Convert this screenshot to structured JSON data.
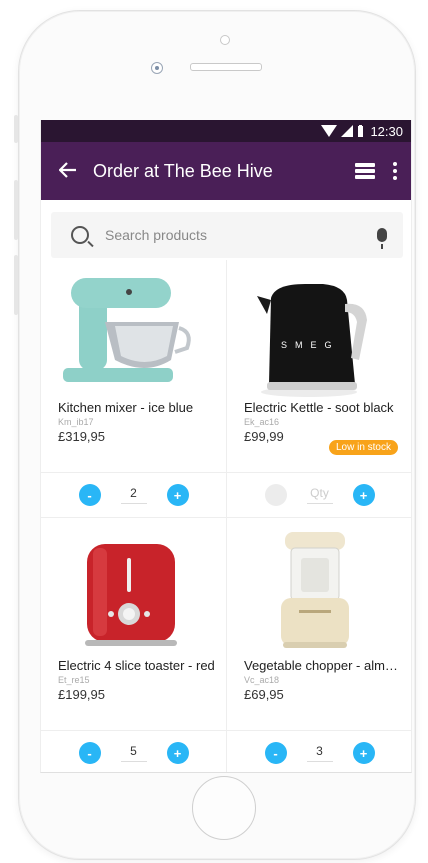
{
  "status": {
    "time": "12:30"
  },
  "appbar": {
    "title": "Order at The Bee Hive"
  },
  "search": {
    "placeholder": "Search products"
  },
  "products": [
    {
      "name": "Kitchen mixer - ice blue",
      "sku": "Km_ib17",
      "price": "£319,95",
      "qty": "2",
      "badge": ""
    },
    {
      "name": "Electric Kettle - soot black",
      "sku": "Ek_ac16",
      "price": "£99,99",
      "qty": "Qty",
      "badge": "Low in stock"
    },
    {
      "name": "Electric 4 slice toaster - red",
      "sku": "Et_re15",
      "price": "£199,95",
      "qty": "5",
      "badge": ""
    },
    {
      "name": "Vegetable chopper - alm…",
      "sku": "Vc_ac18",
      "price": "£69,95",
      "qty": "3",
      "badge": ""
    }
  ],
  "stepper": {
    "minus": "-",
    "plus": "+"
  },
  "colors": {
    "statusbar": "#2a1531",
    "appbar": "#4a1f57",
    "accent": "#29b6f6",
    "badge": "#f8a31a"
  }
}
